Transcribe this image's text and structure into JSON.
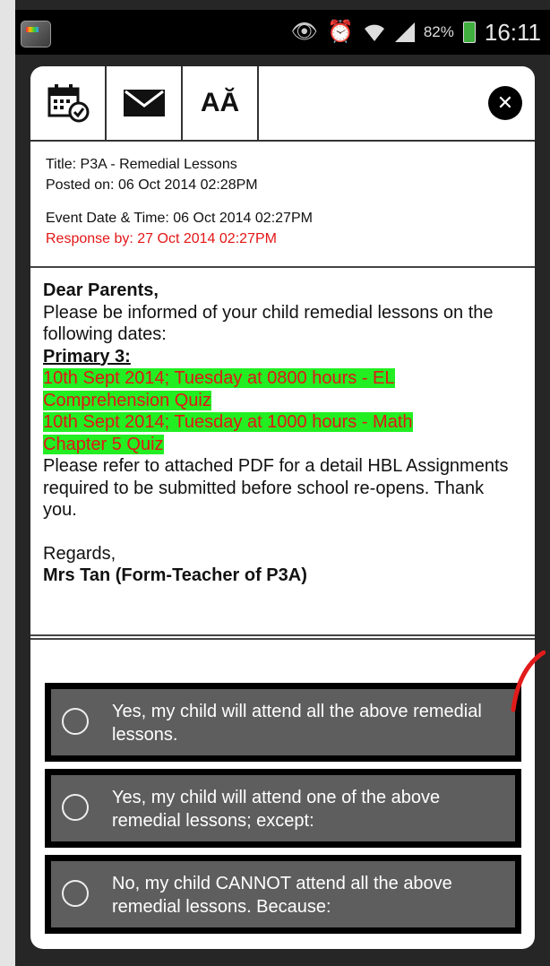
{
  "status_bar": {
    "battery_percent": "82%",
    "time": "16:11"
  },
  "toolbar": {
    "calendar_icon": "calendar-check-icon",
    "mail_icon": "envelope-icon",
    "font_size_label": "AĂ",
    "close_icon": "close-icon"
  },
  "notice": {
    "title_line": "Title: P3A - Remedial Lessons",
    "posted_line": "Posted on: 06 Oct 2014 02:28PM",
    "event_line": "Event Date & Time: 06 Oct 2014 02:27PM",
    "response_line": "Response by: 27 Oct 2014 02:27PM"
  },
  "message": {
    "greeting": "Dear Parents,",
    "intro": "Please be informed of your child remedial lessons on the following dates:",
    "heading": "Primary 3:",
    "date_1a": "10th Sept 2014; Tuesday at 0800 hours - EL",
    "date_1b": "Comprehension Quiz",
    "date_2a": "10th Sept 2014; Tuesday at 1000 hours - Math",
    "date_2b": "Chapter 5 Quiz",
    "closing": "Please refer to attached PDF for a detail HBL Assignments required to be submitted before school re-opens. Thank you.",
    "regards": "Regards,",
    "signature": "Mrs Tan (Form-Teacher of P3A)"
  },
  "options": [
    {
      "label": "Yes, my child will attend all the above remedial lessons."
    },
    {
      "label": "Yes, my child will attend one of the above remedial lessons; except:"
    },
    {
      "label": "No, my child CANNOT attend all the above remedial lessons. Because:"
    }
  ],
  "colors": {
    "highlight_bg": "#22ee22",
    "highlight_text": "#e31616",
    "response_text": "#e31616",
    "option_bg": "#5e5e5e"
  }
}
